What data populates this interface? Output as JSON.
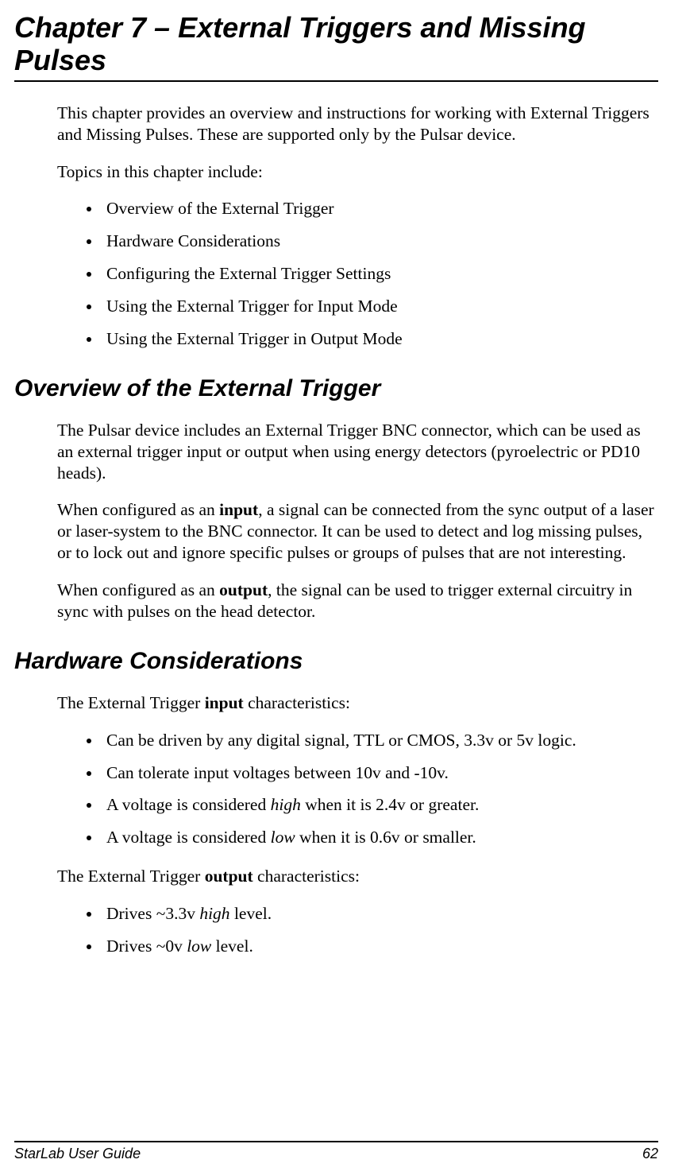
{
  "chapter_title": "Chapter 7 – External Triggers and Missing Pulses",
  "intro_para": "This chapter provides an overview and instructions for working with External Triggers and Missing Pulses. These are supported only by the Pulsar device.",
  "topics_lead": "Topics in this chapter include:",
  "topics": [
    "Overview of the External Trigger",
    "Hardware Considerations",
    "Configuring the External Trigger Settings",
    "Using the External Trigger for Input Mode",
    "Using the External Trigger in Output Mode"
  ],
  "overview": {
    "heading": "Overview of the External Trigger",
    "p1": "The Pulsar device includes an External Trigger BNC connector, which can be used as an external trigger input or output when using energy detectors (pyroelectric or PD10 heads).",
    "p2_pre": "When configured as an ",
    "p2_bold": "input",
    "p2_post": ", a signal can be connected from the sync output of a laser or laser-system to the BNC connector. It can be used to detect and log missing pulses, or to lock out and ignore specific pulses or groups of pulses that are not interesting.",
    "p3_pre": "When configured as an ",
    "p3_bold": "output",
    "p3_post": ", the signal can be used to trigger external circuitry in sync with pulses on the head detector."
  },
  "hardware": {
    "heading": "Hardware Considerations",
    "input_lead_pre": "The External Trigger ",
    "input_lead_bold": "input",
    "input_lead_post": " characteristics:",
    "input_items": {
      "i1": "Can be driven by any digital signal, TTL or CMOS, 3.3v or 5v logic.",
      "i2": "Can tolerate input voltages between 10v and -10v.",
      "i3_pre": "A voltage is considered ",
      "i3_ital": "high",
      "i3_post": " when it is 2.4v or greater.",
      "i4_pre": "A voltage is considered ",
      "i4_ital": "low",
      "i4_post": " when it is 0.6v or smaller."
    },
    "output_lead_pre": "The External Trigger ",
    "output_lead_bold": "output",
    "output_lead_post": " characteristics:",
    "output_items": {
      "o1_pre": "Drives ~3.3v ",
      "o1_ital": "high",
      "o1_post": " level.",
      "o2_pre": "Drives ~0v ",
      "o2_ital": "low",
      "o2_post": " level."
    }
  },
  "footer": {
    "guide": "StarLab User Guide",
    "page": "62"
  }
}
